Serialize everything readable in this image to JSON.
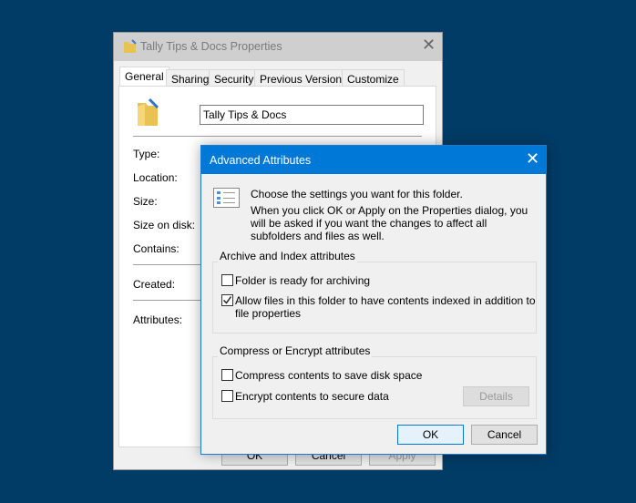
{
  "background_color": "#003c66",
  "properties": {
    "title": "Tally Tips & Docs Properties",
    "tabs": [
      "General",
      "Sharing",
      "Security",
      "Previous Versions",
      "Customize"
    ],
    "name_value": "Tally Tips & Docs",
    "fields": [
      "Type:",
      "Location:",
      "Size:",
      "Size on disk:",
      "Contains:",
      "Created:",
      "Attributes:"
    ],
    "buttons": {
      "ok": "OK",
      "cancel": "Cancel",
      "apply": "Apply"
    }
  },
  "advanced": {
    "title": "Advanced Attributes",
    "accent": "#0078d7",
    "intro": "Choose the settings you want for this folder.",
    "note": "When you click OK or Apply on the Properties dialog, you will be asked if you want the changes to affect all subfolders and files as well.",
    "archive_group": {
      "label": "Archive and Index attributes",
      "options": [
        {
          "label": "Folder is ready for archiving",
          "checked": false
        },
        {
          "label": "Allow files in this folder to have contents indexed in addition to file properties",
          "checked": true
        }
      ]
    },
    "compress_group": {
      "label": "Compress or Encrypt attributes",
      "options": [
        {
          "label": "Compress contents to save disk space",
          "checked": false
        },
        {
          "label": "Encrypt contents to secure data",
          "checked": false
        }
      ],
      "details": "Details"
    },
    "ok": "OK",
    "cancel": "Cancel"
  }
}
